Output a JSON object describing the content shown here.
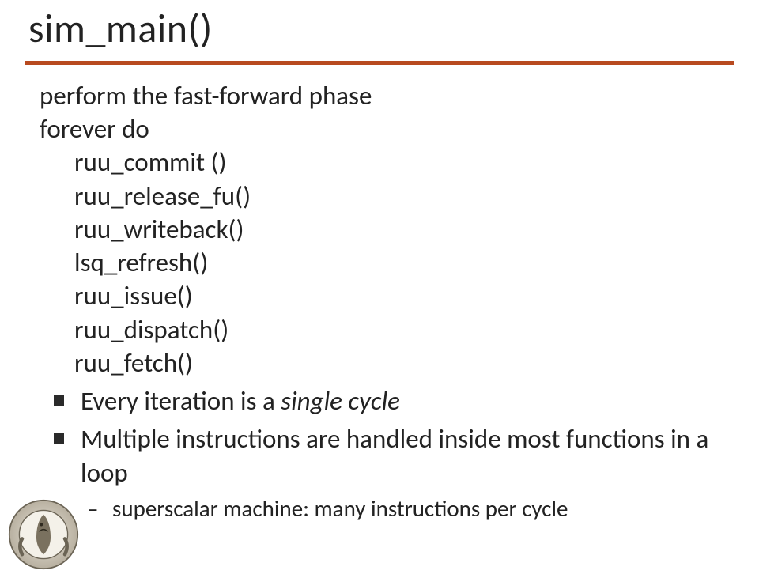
{
  "title": "sim_main()",
  "intro_lines": [
    "perform the fast-forward phase",
    "forever do"
  ],
  "calls": [
    "ruu_commit ()",
    "ruu_release_fu()",
    "ruu_writeback()",
    "lsq_refresh()",
    "ruu_issue()",
    "ruu_dispatch()",
    "ruu_fetch()"
  ],
  "bullets": {
    "b1_prefix": "Every iteration is a ",
    "b1_italic": "single cycle",
    "b2": "Multiple instructions are handled inside most functions in a loop",
    "b2_sub": "superscalar machine: many instructions per cycle"
  },
  "logo_alt": "University of Ioannina Department of Informatics seal"
}
